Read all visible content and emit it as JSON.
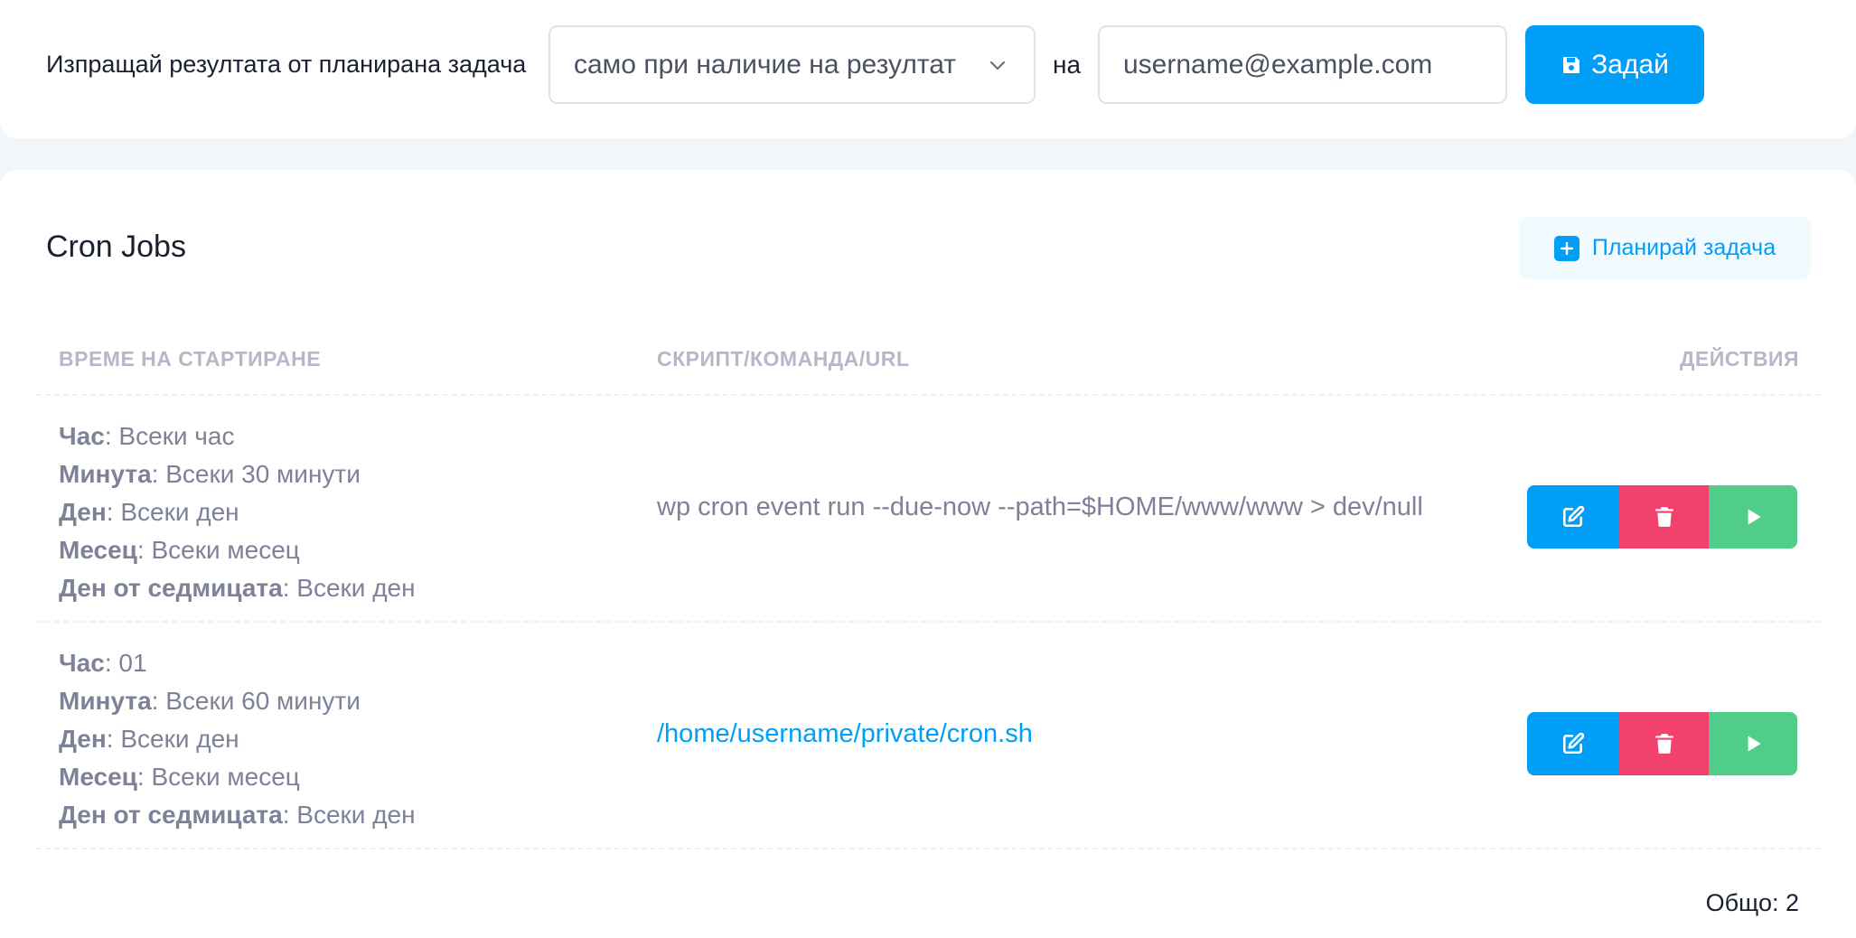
{
  "notify": {
    "label": "Изпращай резултата от планирана задача",
    "select_value": "само при наличие на резултат",
    "to_label": "на",
    "email_value": "username@example.com",
    "set_label": "Задай"
  },
  "cron": {
    "title": "Cron Jobs",
    "schedule_label": "Планирай задача",
    "columns": {
      "time": "ВРЕМЕ НА СТАРТИРАНЕ",
      "script": "СКРИПТ/КОМАНДА/URL",
      "actions": "ДЕЙСТВИЯ"
    },
    "rows": [
      {
        "hour_key": "Час",
        "hour": ": Всеки час",
        "minute_key": "Минута",
        "minute": ": Всеки 30 минути",
        "day_key": "Ден",
        "day": ": Всеки ден",
        "month_key": "Месец",
        "month": ": Всеки месец",
        "weekday_key": "Ден от седмицата",
        "weekday": ": Всеки ден",
        "command": "wp cron event run --due-now --path=$HOME/www/www > dev/null"
      },
      {
        "hour_key": "Час",
        "hour": ": 01",
        "minute_key": "Минута",
        "minute": ": Всеки 60 минути",
        "day_key": "Ден",
        "day": ": Всеки ден",
        "month_key": "Месец",
        "month": ": Всеки месец",
        "weekday_key": "Ден от седмицата",
        "weekday": ": Всеки ден",
        "command": "/home/username/private/cron.sh"
      }
    ],
    "total": "Общо: 2"
  },
  "icons": {
    "select": "chevron-down-icon",
    "set": "save-icon",
    "schedule": "plus-square-icon",
    "edit": "edit-icon",
    "delete": "trash-icon",
    "run": "play-icon"
  },
  "colors": {
    "primary": "#009ef7",
    "danger": "#f1416c",
    "success": "#50cd89",
    "muted": "#7e8299"
  }
}
